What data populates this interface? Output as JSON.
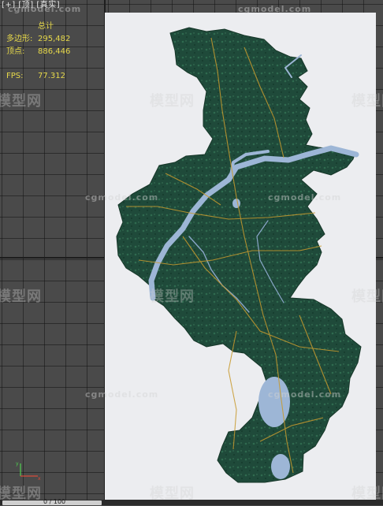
{
  "viewport": {
    "label": "[+] [顶] [真实]"
  },
  "stats": {
    "header": "总计",
    "rows": [
      {
        "key": "多边形:",
        "value": "295,482"
      },
      {
        "key": "顶点:",
        "value": "886,446"
      }
    ],
    "fps_key": "FPS:",
    "fps_value": "77.312"
  },
  "watermarks": {
    "logo_text": "模型网",
    "site_text": "cgmodel.com"
  },
  "timeline": {
    "frame": "0 / 100"
  },
  "colors": {
    "viewport_bg": "#4a4a4a",
    "terrain": "#1f4a3a",
    "water": "#9db6d6",
    "roads": "#c89a2e",
    "stats_text": "#e6d84a"
  }
}
